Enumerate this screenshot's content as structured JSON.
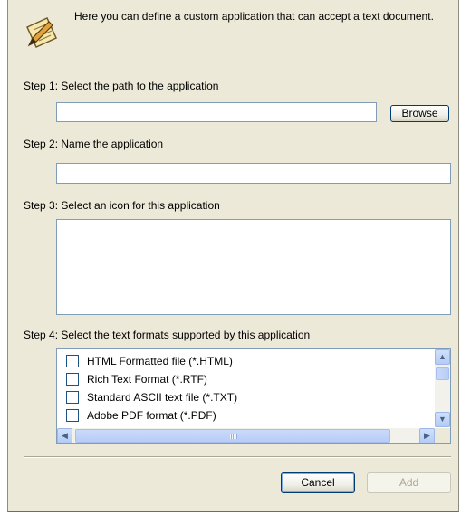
{
  "header": {
    "description": "Here you can define a custom application that can accept a text document."
  },
  "step1": {
    "label": "Step 1: Select the path to the application",
    "path_value": "",
    "browse_label": "Browse"
  },
  "step2": {
    "label": "Step 2: Name the application",
    "name_value": ""
  },
  "step3": {
    "label": "Step 3: Select an icon for this application"
  },
  "step4": {
    "label": "Step 4: Select the text formats supported by this application",
    "formats": [
      {
        "label": "HTML Formatted file (*.HTML)",
        "checked": false
      },
      {
        "label": "Rich Text Format (*.RTF)",
        "checked": false
      },
      {
        "label": "Standard ASCII text file (*.TXT)",
        "checked": false
      },
      {
        "label": "Adobe PDF format (*.PDF)",
        "checked": false
      }
    ]
  },
  "footer": {
    "cancel_label": "Cancel",
    "add_label": "Add"
  },
  "icons": {
    "header": "notepad-pencil-icon",
    "scroll_up": "chevron-up-icon",
    "scroll_down": "chevron-down-icon",
    "scroll_left": "chevron-left-icon",
    "scroll_right": "chevron-right-icon"
  }
}
